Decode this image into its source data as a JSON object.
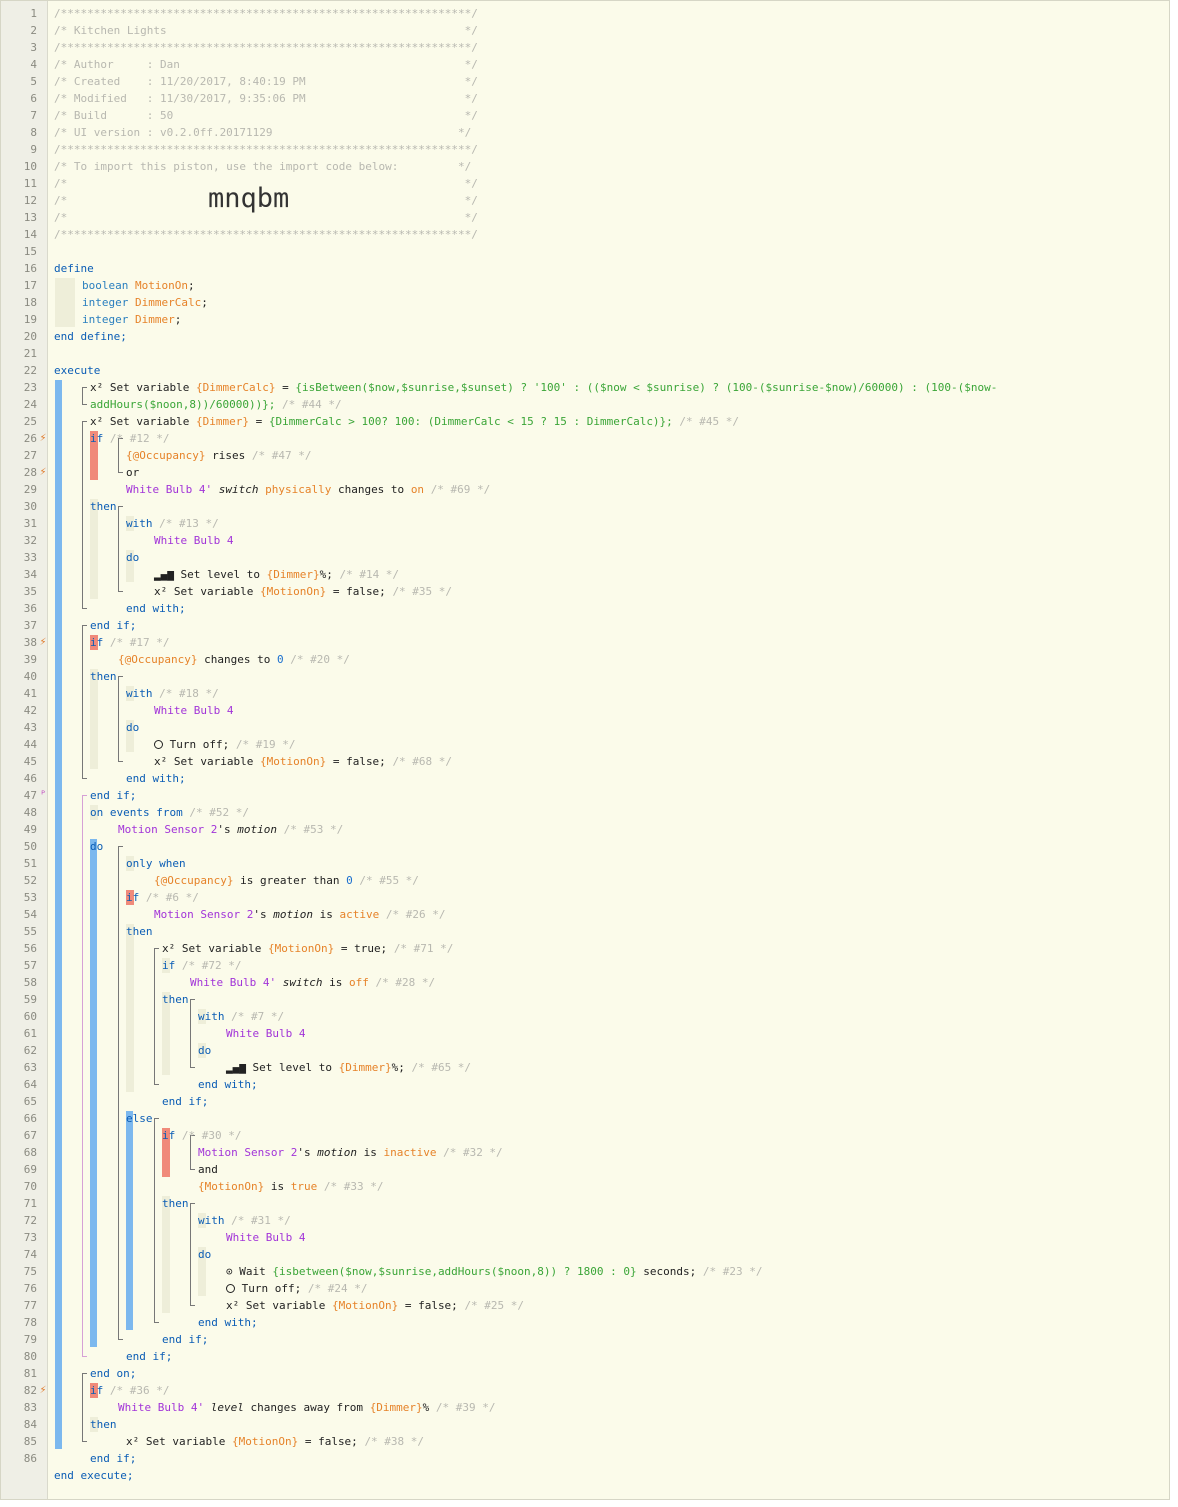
{
  "header": {
    "border": "/**************************************************************/",
    "title": "/* Kitchen Lights                                             */",
    "author": "/* Author     : Dan                                           */",
    "created": "/* Created    : 11/20/2017, 8:40:19 PM                        */",
    "modified": "/* Modified   : 11/30/2017, 9:35:06 PM                        */",
    "build": "/* Build      : 50                                            */",
    "ui_version": "/* UI version : v0.2.0ff.20171129                            */",
    "import_note": "/* To import this piston, use the import code below:         */",
    "blank": "/*                                                            */",
    "import_code": "mnqbm"
  },
  "line_numbers": [
    "1",
    "2",
    "3",
    "4",
    "5",
    "6",
    "7",
    "8",
    "9",
    "10",
    "11",
    "12",
    "13",
    "14",
    "15",
    "16",
    "17",
    "18",
    "19",
    "20",
    "21",
    "22",
    "23",
    "24",
    "25",
    "26",
    "27",
    "28",
    "29",
    "30",
    "31",
    "32",
    "33",
    "34",
    "35",
    "36",
    "37",
    "38",
    "39",
    "40",
    "41",
    "42",
    "43",
    "44",
    "45",
    "46",
    "47",
    "48",
    "49",
    "50",
    "51",
    "52",
    "53",
    "54",
    "55",
    "56",
    "57",
    "58",
    "59",
    "60",
    "61",
    "62",
    "63",
    "64",
    "65",
    "66",
    "67",
    "68",
    "69",
    "70",
    "71",
    "72",
    "73",
    "74",
    "75",
    "76",
    "77",
    "78",
    "79",
    "80",
    "81",
    "82",
    "83",
    "84",
    "85",
    "86"
  ],
  "code": {
    "define": "define",
    "v1_type": "boolean",
    "v1_name": "MotionOn",
    "v2_type": "integer",
    "v2_name": "DimmerCalc",
    "v3_type": "integer",
    "v3_name": "Dimmer",
    "end_define": "end define;",
    "execute": "execute",
    "l23_pre": "x² Set variable ",
    "l23_var": "{DimmerCalc}",
    "l23_eq": " = ",
    "l23_expr": "{isBetween($now,$sunrise,$sunset) ? '100' : (($now < $sunrise) ? (100-($sunrise-$now)/60000) : (100-($now-",
    "l23b_expr": "addHours($noon,8))/60000))};",
    "l23b_cm": " /* #44 */",
    "l24_pre": "x² Set variable ",
    "l24_var": "{Dimmer}",
    "l24_eq": " = ",
    "l24_expr": "{DimmerCalc > 100? 100: (DimmerCalc < 15 ? 15 : DimmerCalc)};",
    "l24_cm": " /* #45 */",
    "if": "if",
    "then": "then",
    "else": "else",
    "do": "do",
    "with": "with",
    "or": "or",
    "and": "and",
    "end_if": "end if;",
    "end_with": "end with;",
    "end_on": "end on;",
    "end_execute": "end execute;",
    "c12": "/* #12 */",
    "occ": "{@Occupancy}",
    "rises": " rises",
    "c47": "/* #47 */",
    "wb4p": "White Bulb 4'",
    "switch": "switch",
    "physically": "physically",
    "changes_to": " changes to ",
    "on": "on",
    "c69": "/* #69 */",
    "c13": "/* #13 */",
    "wb4": "White Bulb 4",
    "set_level_to": "Set level to ",
    "dimmer": "{Dimmer}",
    "pct": "%;",
    "c14": "/* #14 */",
    "setvar": "x² Set variable ",
    "motionon": "{MotionOn}",
    "eq_false": " = false;",
    "eq_true": " = true;",
    "c35": "/* #35 */",
    "c17": "/* #17 */",
    "changes_to_0_a": " changes to ",
    "zero": "0",
    "c20": "/* #20 */",
    "c18": "/* #18 */",
    "turn_off": "Turn off;",
    "c19": "/* #19 */",
    "c68": "/* #68 */",
    "on_events_from": "on events from",
    "c52": "/* #52 */",
    "ms2": "Motion Sensor 2",
    "s_motion_a": "'s ",
    "motion": "motion",
    "c53": "/* #53 */",
    "only_when": "only when",
    "greater": " is greater than ",
    "c55": "/* #55 */",
    "c6": "/* #6 */",
    "is": " is ",
    "active": "active",
    "c26": "/* #26 */",
    "c71": "/* #71 */",
    "c72": "/* #72 */",
    "off": "off",
    "c28": "/* #28 */",
    "c7": "/* #7 */",
    "c65": "/* #65 */",
    "c30": "/* #30 */",
    "inactive": "inactive",
    "c32": "/* #32 */",
    "is_true_a": " is ",
    "true": "true",
    "c33": "/* #33 */",
    "c31": "/* #31 */",
    "wait": "Wait ",
    "wait_expr": "{isbetween($now,$sunrise,addHours($noon,8)) ? 1800 : 0}",
    "seconds": " seconds;",
    "c23": "/* #23 */",
    "c24": "/* #24 */",
    "c25": "/* #25 */",
    "c36": "/* #36 */",
    "level": "level",
    "changes_away": " changes away from ",
    "c39": "/* #39 */",
    "c38": "/* #38 */"
  },
  "colors": {
    "keyword": "#0b5db5",
    "variable": "#e6832a",
    "device": "#a234d8",
    "expression": "#3aa537",
    "comment": "#b8b8b0",
    "block_bar": "#7cb8ee",
    "condition_bar": "#f08a7a"
  }
}
